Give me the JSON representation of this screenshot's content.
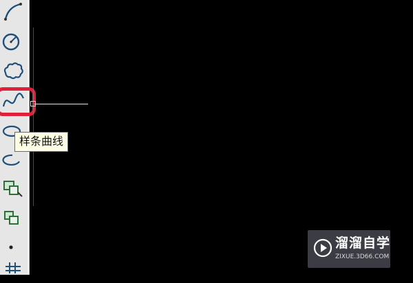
{
  "toolbar": {
    "tools": [
      {
        "name": "arc-icon"
      },
      {
        "name": "circle-icon"
      },
      {
        "name": "revision-cloud-icon"
      },
      {
        "name": "spline-icon",
        "highlighted": true
      },
      {
        "name": "ellipse-icon"
      },
      {
        "name": "ellipse-arc-icon"
      },
      {
        "name": "insert-block-icon"
      },
      {
        "name": "make-block-icon"
      },
      {
        "name": "point-icon"
      },
      {
        "name": "hatch-icon"
      }
    ]
  },
  "tooltip": {
    "text": "样条曲线"
  },
  "watermark": {
    "title": "溜溜自学",
    "url": "ZIXUE.3D66.COM"
  },
  "colors": {
    "highlight": "#e0203a",
    "canvas": "#000000",
    "toolbar": "#e6e6e6",
    "tooltip_bg": "#ffffe6"
  }
}
